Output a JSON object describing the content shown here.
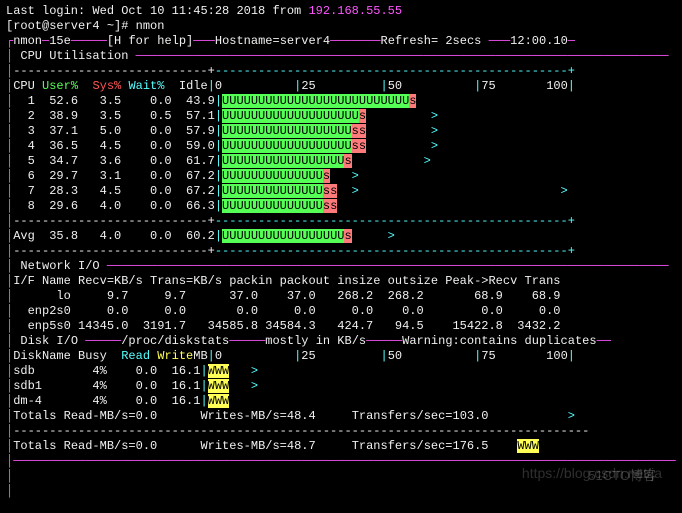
{
  "login": {
    "prefix": "Last login:",
    "time": "Wed Oct 10 11:45:28 2018 from",
    "ip": "192.168.55.55"
  },
  "prompt": {
    "left": "[root@server4 ~]#",
    "cmd": "nmon"
  },
  "header": {
    "prog": "nmon",
    "ver": "15e",
    "help": "[H for help]",
    "hostlabel": "Hostname=",
    "hostname": "server4",
    "refresh": "Refresh= 2secs",
    "clock": "12:00.10"
  },
  "sections": {
    "cpu": "CPU Utilisation",
    "net": "Network I/O",
    "disk": "Disk I/O"
  },
  "cpu": {
    "hdr": {
      "c0": "CPU",
      "c1": "User%",
      "c2": "Sys%",
      "c3": "Wait%",
      "c4": "Idle"
    },
    "scale": {
      "s0": "0",
      "s25": "25",
      "s50": "50",
      "s75": "75",
      "s100": "100"
    },
    "rows": [
      {
        "id": "1",
        "u": "52.6",
        "s": "3.5",
        "w": "0.0",
        "i": "43.9",
        "bar_u": "UUUUUUUUUUUUUUUUUUUUUUUUUU",
        "bar_s": "s",
        "bar_tail": ""
      },
      {
        "id": "2",
        "u": "38.9",
        "s": "3.5",
        "w": "0.5",
        "i": "57.1",
        "bar_u": "UUUUUUUUUUUUUUUUUUU",
        "bar_s": "s",
        "bar_tail": "         >"
      },
      {
        "id": "3",
        "u": "37.1",
        "s": "5.0",
        "w": "0.0",
        "i": "57.9",
        "bar_u": "UUUUUUUUUUUUUUUUUU",
        "bar_s": "ss",
        "bar_tail": "         >"
      },
      {
        "id": "4",
        "u": "36.5",
        "s": "4.5",
        "w": "0.0",
        "i": "59.0",
        "bar_u": "UUUUUUUUUUUUUUUUUU",
        "bar_s": "ss",
        "bar_tail": "         >"
      },
      {
        "id": "5",
        "u": "34.7",
        "s": "3.6",
        "w": "0.0",
        "i": "61.7",
        "bar_u": "UUUUUUUUUUUUUUUUU",
        "bar_s": "s",
        "bar_tail": "          >"
      },
      {
        "id": "6",
        "u": "29.7",
        "s": "3.1",
        "w": "0.0",
        "i": "67.2",
        "bar_u": "UUUUUUUUUUUUUU",
        "bar_s": "s",
        "bar_tail": "   >"
      },
      {
        "id": "7",
        "u": "28.3",
        "s": "4.5",
        "w": "0.0",
        "i": "67.2",
        "bar_u": "UUUUUUUUUUUUUU",
        "bar_s": "ss",
        "bar_tail": "  >                            >"
      },
      {
        "id": "8",
        "u": "29.6",
        "s": "4.0",
        "w": "0.0",
        "i": "66.3",
        "bar_u": "UUUUUUUUUUUUUU",
        "bar_s": "ss",
        "bar_tail": ""
      }
    ],
    "avg": {
      "id": "Avg",
      "u": "35.8",
      "s": "4.0",
      "w": "0.0",
      "i": "60.2",
      "bar_u": "UUUUUUUUUUUUUUUUU",
      "bar_s": "s",
      "bar_tail": "     >"
    }
  },
  "net": {
    "hdr": "I/F Name Recv=KB/s Trans=KB/s packin packout insize outsize Peak->Recv Trans",
    "rows": [
      "      lo     9.7     9.7      37.0    37.0   268.2  268.2       68.9    68.9",
      "  enp2s0     0.0     0.0       0.0     0.0     0.0    0.0        0.0     0.0",
      "  enp5s0 14345.0  3191.7   34585.8 34584.3   424.7   94.5    15422.8  3432.2"
    ]
  },
  "disk": {
    "hdr_path": "/proc/diskstats",
    "hdr_mid": "mostly in KB/s",
    "hdr_warn": "Warning:contains duplicates",
    "cols": {
      "c0": "DiskName",
      "c1": "Busy",
      "c2": "Read",
      "c3": "Write",
      "c4": "MB"
    },
    "scale": {
      "s0": "0",
      "s25": "25",
      "s50": "50",
      "s75": "75",
      "s100": "100"
    },
    "rows": [
      {
        "name": "sdb  ",
        "busy": "4%",
        "r": "0.0",
        "w": "16.1",
        "bar": "WWW",
        "tail": "   >"
      },
      {
        "name": "sdb1 ",
        "busy": "4%",
        "r": "0.0",
        "w": "16.1",
        "bar": "WWW",
        "tail": "   >"
      },
      {
        "name": "dm-4 ",
        "busy": "4%",
        "r": "0.0",
        "w": "16.1",
        "bar": "WWW",
        "tail": ""
      }
    ],
    "tot1": {
      "l": "Totals Read-MB/s=0.0",
      "m": "Writes-MB/s=48.4",
      "r": "Transfers/sec=103.0",
      "t": ">"
    },
    "tot2": {
      "l": "Totals Read-MB/s=0.0",
      "m": "Writes-MB/s=48.7",
      "r": "Transfers/sec=176.5",
      "bar": "WWW"
    }
  },
  "watermark1": "https://blog.csdn.net/ja",
  "watermark2": "51CTO博客"
}
